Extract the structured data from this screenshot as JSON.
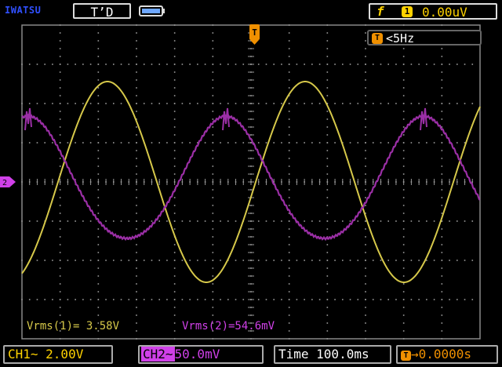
{
  "header": {
    "brand": "IWATSU",
    "mode": "T’D",
    "trigger_edge_symbol": "f",
    "trigger_source": "1",
    "trigger_level": "0.00uV"
  },
  "screen": {
    "trigger_marker": "T",
    "frequency_icon": "T",
    "frequency": "<5Hz",
    "ch2_marker": "2"
  },
  "measurements": {
    "m1": "Vrms(1)= 3.58V",
    "m2": "Vrms(2)=54.6mV"
  },
  "footer": {
    "ch1": "CH1∼  2.00V",
    "ch2_tag": "CH2∼",
    "ch2_scale": "50.0mV",
    "time": "Time 100.0ms",
    "trigger_icon": "T",
    "trigger_pos": "→0.0000s"
  },
  "colors": {
    "ch1": "#d6c84a",
    "ch2": "#d040e8",
    "trigger": "#f09000",
    "grid": "#9a9a9a"
  }
}
